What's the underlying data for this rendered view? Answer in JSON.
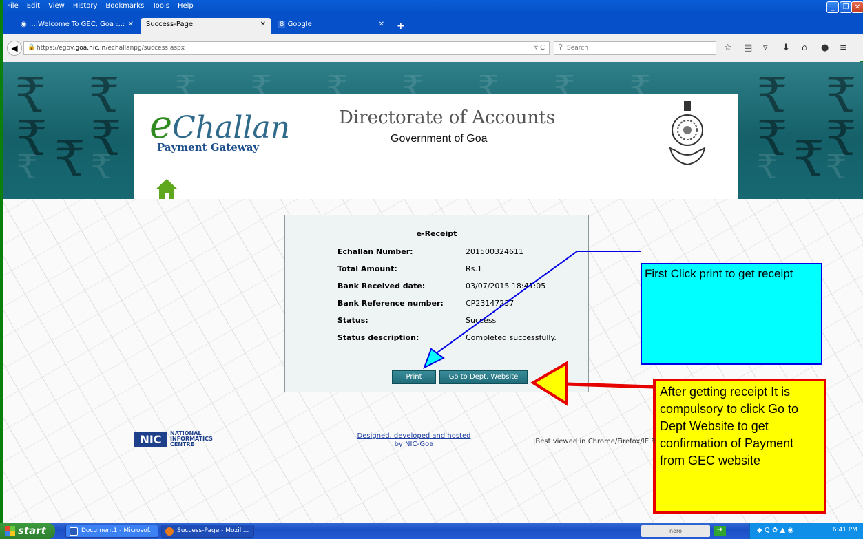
{
  "browser": {
    "menu": [
      "File",
      "Edit",
      "View",
      "History",
      "Bookmarks",
      "Tools",
      "Help"
    ],
    "tabs": [
      {
        "label": ":..:Welcome To GEC, Goa :..:",
        "active": false
      },
      {
        "label": "Success-Page",
        "active": true
      },
      {
        "label": "Google",
        "active": false
      }
    ],
    "url_prefix": "https://egov.",
    "url_domain": "goa.nic.in",
    "url_path": "/echallanpg/success.aspx",
    "search_placeholder": "Search",
    "new_tab": "+"
  },
  "header": {
    "logo_prefix": "e",
    "logo_word": "Challan",
    "logo_sub": "Payment Gateway",
    "title": "Directorate of Accounts",
    "subtitle": "Government of Goa"
  },
  "receipt": {
    "title": "e-Receipt",
    "rows": [
      {
        "label": "Echallan Number:",
        "value": "201500324611"
      },
      {
        "label": "Total Amount:",
        "value": "Rs.1"
      },
      {
        "label": "Bank Received date:",
        "value": "03/07/2015 18:41:05"
      },
      {
        "label": "Bank Reference number:",
        "value": "CP23147237"
      },
      {
        "label": "Status:",
        "value": "Success"
      },
      {
        "label": "Status description:",
        "value": "Completed successfully."
      }
    ],
    "print_label": "Print",
    "dept_label": "Go to Dept. Website"
  },
  "annotations": {
    "callout1": "First Click print to get receipt",
    "callout2": "After getting receipt It is compulsory to click Go to Dept Website to get confirmation of Payment from GEC website"
  },
  "footer": {
    "nic_line1": "NATIONAL",
    "nic_line2": "INFORMATICS",
    "nic_line3": "CENTRE",
    "nic_logo": "NIC",
    "dev_line1": "Designed, developed and hosted",
    "dev_line2": "by NIC-Goa",
    "best_viewed": "|Best viewed in Chrome/Firefox/IE 8"
  },
  "taskbar": {
    "start": "start",
    "items": [
      {
        "label": "Document1 - Microsof..."
      },
      {
        "label": "Success-Page - Mozill..."
      }
    ],
    "nero": "nero",
    "clock": "6:41 PM"
  },
  "colors": {
    "banner": "#176872",
    "callout_cyan": "#00ffff",
    "callout_yellow": "#ffff00",
    "callout_red_border": "#e60000",
    "arrow_blue": "#0000e6",
    "button_teal": "#1e6b78"
  }
}
